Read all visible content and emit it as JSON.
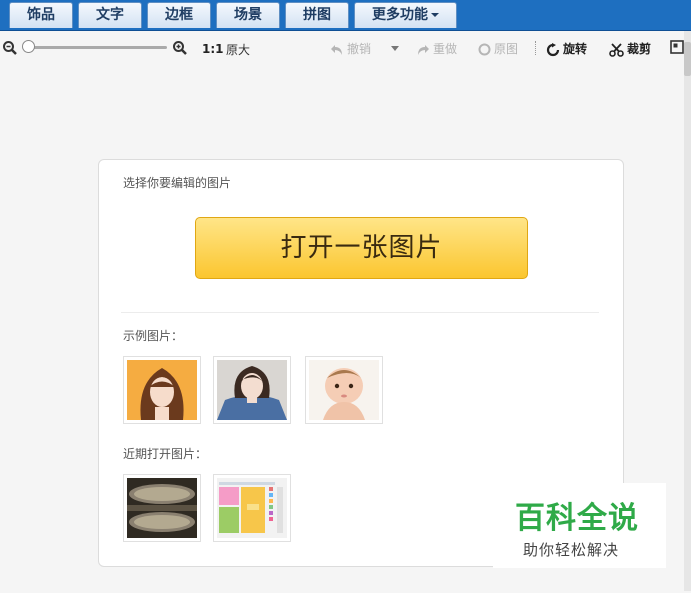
{
  "tabs": [
    {
      "label": "饰品"
    },
    {
      "label": "文字"
    },
    {
      "label": "边框"
    },
    {
      "label": "场景"
    },
    {
      "label": "拼图"
    },
    {
      "label": "更多功能"
    }
  ],
  "toolbar": {
    "zoom_level": "1:1",
    "original_size": "原大",
    "undo": "撤销",
    "redo": "重做",
    "original_image": "原图",
    "rotate": "旋转",
    "crop": "裁剪"
  },
  "card": {
    "select_label": "选择你要编辑的图片",
    "open_button": "打开一张图片",
    "sample_label": "示例图片：",
    "recent_label": "近期打开图片："
  },
  "samples": [
    {
      "name": "sample-girl-bangs"
    },
    {
      "name": "sample-girl-denim"
    },
    {
      "name": "sample-baby"
    }
  ],
  "recent": [
    {
      "name": "recent-coins"
    },
    {
      "name": "recent-collage"
    }
  ],
  "watermark": {
    "title": "百科全说",
    "subtitle": "助你轻松解决"
  },
  "colors": {
    "tabbar": "#1e6fc0",
    "button": "#fbc62f",
    "watermark": "#2faa48"
  }
}
